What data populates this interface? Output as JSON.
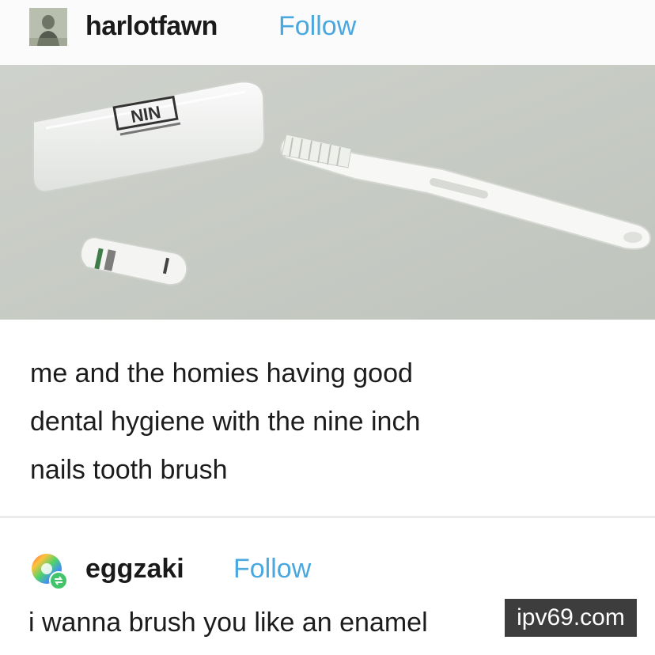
{
  "post": {
    "author": "harlotfawn",
    "follow_label": "Follow",
    "image_logo_text": "NIN",
    "caption_lines": [
      "me and the homies having good",
      "dental hygiene with the nine inch",
      "nails tooth brush"
    ]
  },
  "reply": {
    "author": "eggzaki",
    "follow_label": "Follow",
    "text": "i wanna brush you like an enamel"
  },
  "watermark": "ipv69.com",
  "colors": {
    "follow": "#4aa8e0",
    "photo_background": "#c7cbc4",
    "watermark_background": "#3d3d3d"
  },
  "icons": {
    "avatar1": "profile-photo-avatar",
    "avatar2": "rainbow-circle-avatar-with-reblog-badge"
  }
}
